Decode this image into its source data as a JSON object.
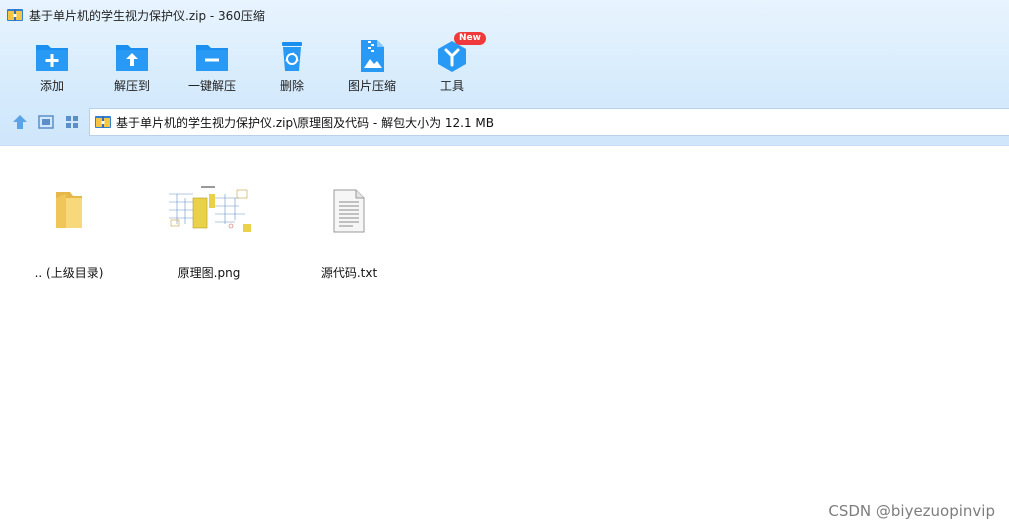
{
  "window": {
    "title": "基于单片机的学生视力保护仪.zip - 360压缩"
  },
  "toolbar": {
    "items": [
      {
        "label": "添加",
        "icon": "add-folder-icon"
      },
      {
        "label": "解压到",
        "icon": "extract-to-icon"
      },
      {
        "label": "一键解压",
        "icon": "one-click-extract-icon"
      },
      {
        "label": "删除",
        "icon": "trash-icon"
      },
      {
        "label": "图片压缩",
        "icon": "image-compress-icon"
      },
      {
        "label": "工具",
        "icon": "tools-icon"
      }
    ],
    "new_badge": "New"
  },
  "address": {
    "path": "基于单片机的学生视力保护仪.zip\\原理图及代码 - 解包大小为 12.1 MB"
  },
  "files": [
    {
      "name": ".. (上级目录)",
      "icon": "folder-icon"
    },
    {
      "name": "原理图.png",
      "icon": "image-thumbnail"
    },
    {
      "name": "源代码.txt",
      "icon": "text-file-icon"
    }
  ],
  "watermark": "CSDN @biyezuopinvip",
  "colors": {
    "accent": "#1a8ff0",
    "badge": "#f0393a",
    "folder": "#f5cf6a"
  }
}
